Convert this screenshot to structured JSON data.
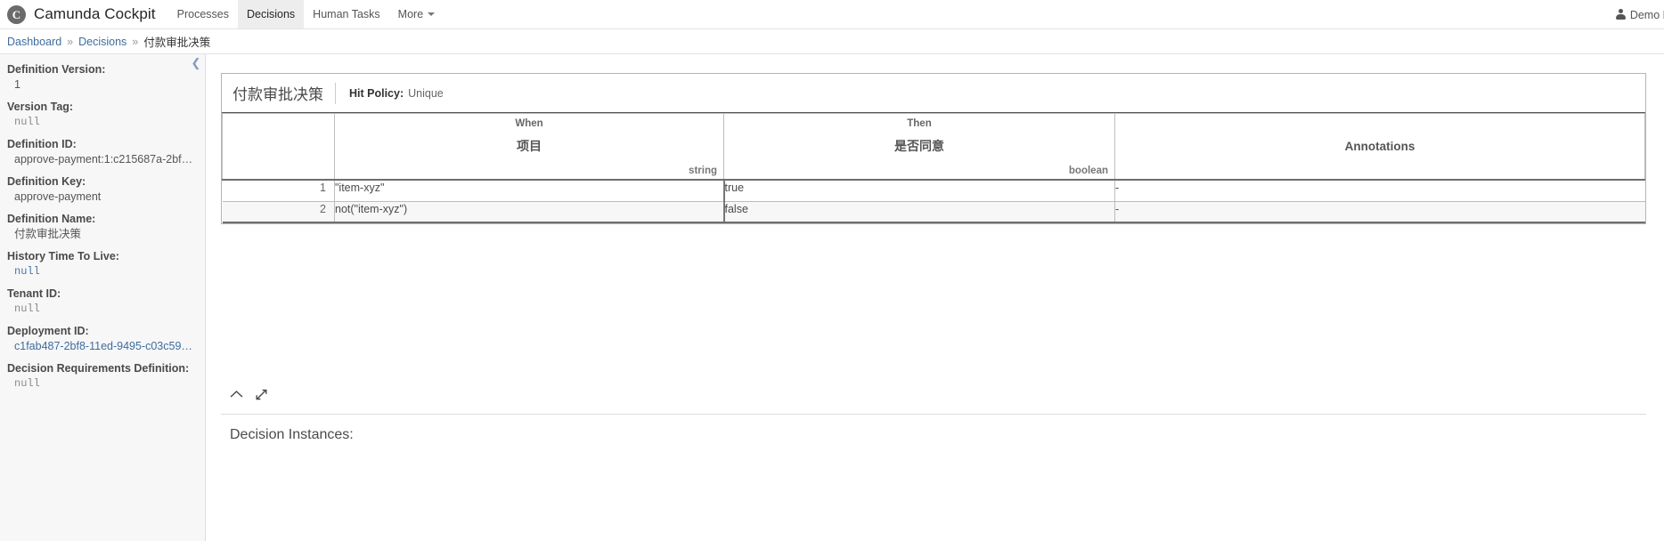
{
  "navbar": {
    "logo_icon": "camunda-logo-icon",
    "logo_glyph": "C",
    "title": "Camunda Cockpit",
    "items": [
      {
        "label": "Processes",
        "active": false,
        "caret": false
      },
      {
        "label": "Decisions",
        "active": true,
        "caret": false
      },
      {
        "label": "Human Tasks",
        "active": false,
        "caret": false
      },
      {
        "label": "More",
        "active": false,
        "caret": true
      }
    ],
    "user": {
      "icon": "user-icon",
      "name": "Demo Demo"
    }
  },
  "breadcrumb": {
    "items": [
      {
        "label": "Dashboard",
        "link": true
      },
      {
        "label": "Decisions",
        "link": true
      },
      {
        "label": "付款审批决策",
        "link": false
      }
    ],
    "separator": "»"
  },
  "sidebar": {
    "collapse_icon": "chevron-left-icon",
    "properties": [
      {
        "label": "Definition Version:",
        "value": "1",
        "style": "plain"
      },
      {
        "label": "Version Tag:",
        "value": "null",
        "style": "mono"
      },
      {
        "label": "Definition ID:",
        "value": "approve-payment:1:c215687a-2bf8-...",
        "style": "plain"
      },
      {
        "label": "Definition Key:",
        "value": "approve-payment",
        "style": "plain"
      },
      {
        "label": "Definition Name:",
        "value": "付款审批决策",
        "style": "cjk"
      },
      {
        "label": "History Time To Live:",
        "value": "null",
        "style": "mono-link"
      },
      {
        "label": "Tenant ID:",
        "value": "null",
        "style": "mono"
      },
      {
        "label": "Deployment ID:",
        "value": "c1fab487-2bf8-11ed-9495-c03c59a...",
        "style": "link"
      },
      {
        "label": "Decision Requirements Definition:",
        "value": "null",
        "style": "mono"
      }
    ]
  },
  "decision_table": {
    "name": "付款审批决策",
    "hit_policy_label": "Hit Policy:",
    "hit_policy_value": "Unique",
    "columns": {
      "index": "",
      "input": {
        "clause": "When",
        "title": "项目",
        "type": "string"
      },
      "output": {
        "clause": "Then",
        "title": "是否同意",
        "type": "boolean"
      },
      "annotations": "Annotations"
    },
    "rows": [
      {
        "index": "1",
        "input": "\"item-xyz\"",
        "output": "true",
        "annotation": "-"
      },
      {
        "index": "2",
        "input": "not(\"item-xyz\")",
        "output": "false",
        "annotation": "-"
      }
    ],
    "controls": [
      {
        "icon": "chevron-up-icon",
        "name": "collapse-table-button"
      },
      {
        "icon": "expand-diagonal-icon",
        "name": "fullscreen-table-button"
      }
    ]
  },
  "instances": {
    "title": "Decision Instances:"
  }
}
